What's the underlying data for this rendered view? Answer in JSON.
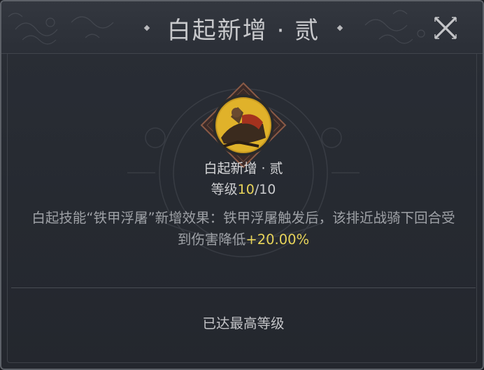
{
  "header": {
    "title": "白起新增 · 贰",
    "close_icon": "close-x-icon"
  },
  "skill": {
    "icon": "cavalry-warrior-portrait-icon",
    "name": "白起新增 · 贰",
    "level_prefix": "等级",
    "level_current": "10",
    "level_max": "/10",
    "description_main": "白起技能“铁甲浮屠”新增效果：铁甲浮屠触发后，该排近战骑下回合受到伤害降低",
    "description_bonus": "+20.00%"
  },
  "footer": {
    "status": "已达最高等级"
  },
  "colors": {
    "accent_value": "#e8d45a",
    "panel_bg": "#272b32",
    "text_main": "#d8d9db",
    "text_desc": "#9ea1a6"
  }
}
